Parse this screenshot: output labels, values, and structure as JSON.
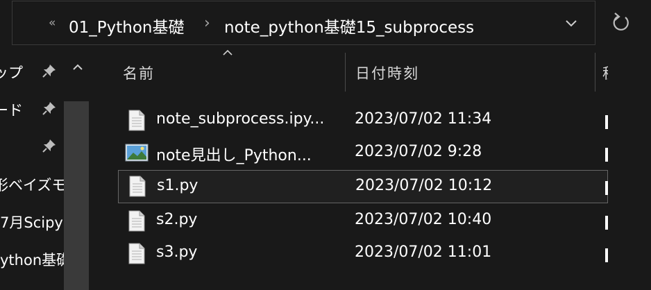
{
  "address_bar": {
    "overflow_glyph": "«",
    "separator_glyph": "›",
    "breadcrumbs": [
      "01_Python基礎",
      "note_python基礎15_subprocess"
    ]
  },
  "nav": {
    "items": [
      {
        "label": "ップ",
        "pinned": true
      },
      {
        "label": "ード",
        "pinned": true
      },
      {
        "label": "",
        "pinned": true
      },
      {
        "label": "形ベイズモ",
        "pinned": false
      },
      {
        "label": "7月Scipy",
        "pinned": false
      },
      {
        "label": "ython基礎",
        "pinned": false
      }
    ]
  },
  "columns": {
    "name": "名前",
    "date": "日付時刻",
    "type_partial": "種"
  },
  "files": [
    {
      "name": "note_subprocess.ipy...",
      "date": "2023/07/02 11:34",
      "icon": "document-icon"
    },
    {
      "name": "note見出し_Python...",
      "date": "2023/07/02 9:28",
      "icon": "image-icon"
    },
    {
      "name": "s1.py",
      "date": "2023/07/02 10:12",
      "icon": "document-icon"
    },
    {
      "name": "s2.py",
      "date": "2023/07/02 10:40",
      "icon": "document-icon"
    },
    {
      "name": "s3.py",
      "date": "2023/07/02 11:01",
      "icon": "document-icon"
    }
  ],
  "colors": {
    "background": "#191919",
    "folder": "#e8c15a",
    "hover_border": "#666666"
  }
}
